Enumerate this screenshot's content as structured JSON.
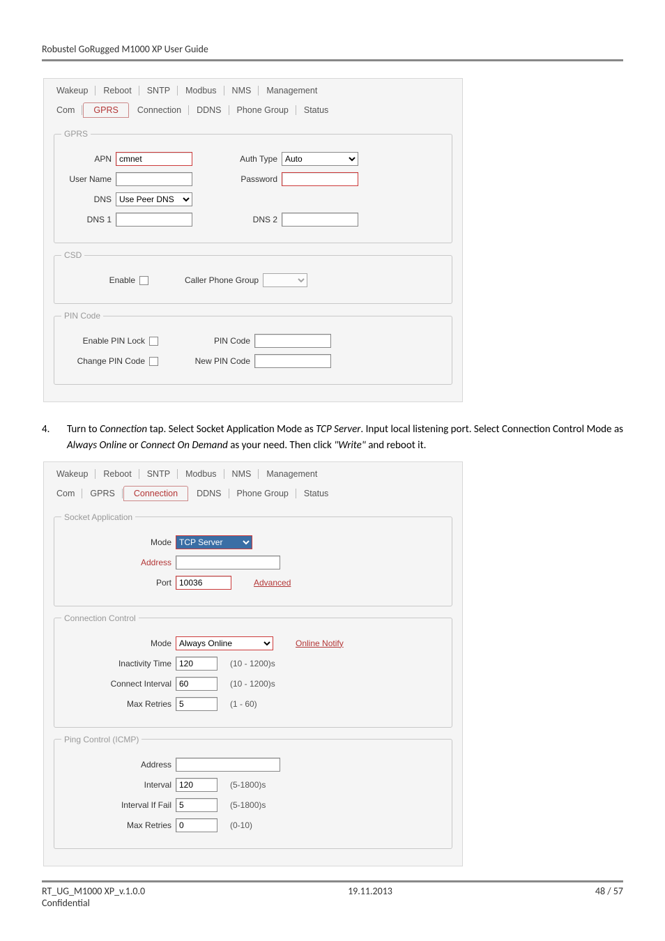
{
  "doc_title": "Robustel GoRugged M1000 XP User Guide",
  "tabs_row1": [
    "Wakeup",
    "Reboot",
    "SNTP",
    "Modbus",
    "NMS",
    "Management"
  ],
  "tabs_row2": [
    "Com",
    "GPRS",
    "Connection",
    "DDNS",
    "Phone Group",
    "Status"
  ],
  "active_tab_shot1": "GPRS",
  "gprs": {
    "legend": "GPRS",
    "apn_label": "APN",
    "apn_value": "cmnet",
    "authtype_label": "Auth Type",
    "authtype_value": "Auto",
    "username_label": "User Name",
    "password_label": "Password",
    "dns_label": "DNS",
    "dns_value": "Use Peer DNS",
    "dns1_label": "DNS 1",
    "dns2_label": "DNS 2"
  },
  "csd": {
    "legend": "CSD",
    "enable_label": "Enable",
    "caller_label": "Caller Phone Group"
  },
  "pin": {
    "legend": "PIN Code",
    "enable_label": "Enable PIN Lock",
    "pincode_label": "PIN Code",
    "change_label": "Change PIN Code",
    "newpin_label": "New PIN Code"
  },
  "step4_num": "4.",
  "step4_a": "Turn to ",
  "step4_b": "Connection",
  "step4_c": " tap. Select Socket Application Mode as ",
  "step4_d": "TCP Server",
  "step4_e": ". Input local listening port. Select Connection Control Mode as ",
  "step4_f": "Always Online",
  "step4_g": " or ",
  "step4_h": "Connect On Demand",
  "step4_i": " as your need. Then click ",
  "step4_j": "\"Write\"",
  "step4_k": " and reboot it.",
  "active_tab_shot2": "Connection",
  "sockapp": {
    "legend": "Socket Application",
    "mode_label": "Mode",
    "mode_value": "TCP Server",
    "addr_label": "Address",
    "port_label": "Port",
    "port_value": "10036",
    "advanced": "Advanced"
  },
  "connctrl": {
    "legend": "Connection Control",
    "mode_label": "Mode",
    "mode_value": "Always Online",
    "online_notify": "Online Notify",
    "inactivity_label": "Inactivity Time",
    "inactivity_value": "120",
    "inactivity_hint": "(10 - 1200)s",
    "connint_label": "Connect Interval",
    "connint_value": "60",
    "connint_hint": "(10 - 1200)s",
    "maxretries_label": "Max Retries",
    "maxretries_value": "5",
    "maxretries_hint": "(1 - 60)"
  },
  "ping": {
    "legend": "Ping Control (ICMP)",
    "addr_label": "Address",
    "interval_label": "Interval",
    "interval_value": "120",
    "interval_hint": "(5-1800)s",
    "intfail_label": "Interval If Fail",
    "intfail_value": "5",
    "intfail_hint": "(5-1800)s",
    "maxretries_label": "Max Retries",
    "maxretries_value": "0",
    "maxretries_hint": "(0-10)"
  },
  "footer_left": "RT_UG_M1000 XP_v.1.0.0",
  "footer_mid": "19.11.2013",
  "footer_right": "48 / 57",
  "footer_conf": "Confidential"
}
